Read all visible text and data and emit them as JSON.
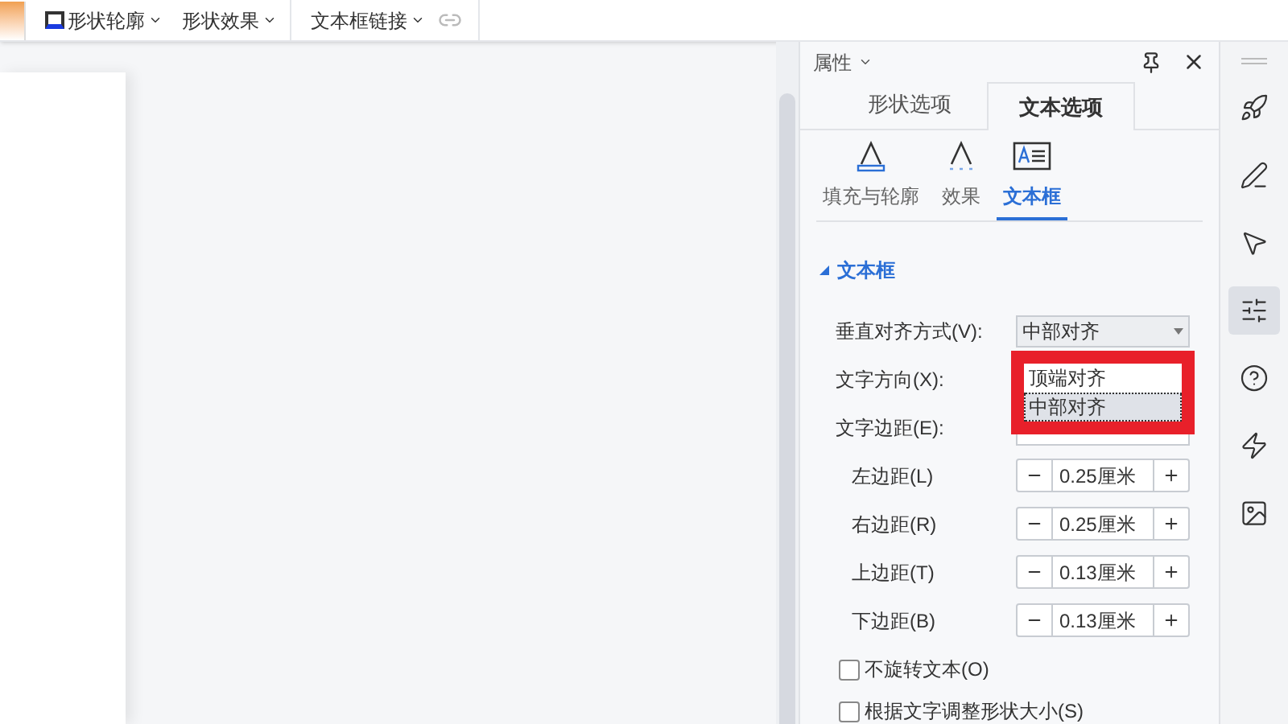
{
  "toolbar": {
    "items": [
      {
        "label": "形状轮廓",
        "kind": "outline"
      },
      {
        "label": "形状效果",
        "kind": "plain"
      },
      {
        "label": "文本框链接",
        "kind": "plain"
      }
    ]
  },
  "panel": {
    "title": "属性",
    "tabs": [
      {
        "label": "形状选项",
        "selected": false
      },
      {
        "label": "文本选项",
        "selected": true
      }
    ],
    "subtabs": [
      {
        "label": "填充与轮廓",
        "kind": "fill",
        "selected": false
      },
      {
        "label": "效果",
        "kind": "effect",
        "selected": false
      },
      {
        "label": "文本框",
        "kind": "textbox",
        "selected": true
      }
    ],
    "section": {
      "title": "文本框",
      "expanded": true
    },
    "vertical_align": {
      "label": "垂直对齐方式(V):",
      "value": "中部对齐"
    },
    "dropdown_options": [
      {
        "label": "顶端对齐",
        "selected": false
      },
      {
        "label": "中部对齐",
        "selected": true
      }
    ],
    "text_direction": {
      "label": "文字方向(X):"
    },
    "text_margin": {
      "label": "文字边距(E):"
    },
    "margins": [
      {
        "label": "左边距(L)",
        "value": "0.25厘米"
      },
      {
        "label": "右边距(R)",
        "value": "0.25厘米"
      },
      {
        "label": "上边距(T)",
        "value": "0.13厘米"
      },
      {
        "label": "下边距(B)",
        "value": "0.13厘米"
      }
    ],
    "checkboxes": [
      {
        "label": "不旋转文本(O)",
        "checked": false
      },
      {
        "label": "根据文字调整形状大小(S)",
        "checked": false
      }
    ]
  },
  "rail": [
    {
      "kind": "rocket",
      "selected": false
    },
    {
      "kind": "pen",
      "selected": false
    },
    {
      "kind": "cursor",
      "selected": false
    },
    {
      "kind": "sliders",
      "selected": true
    },
    {
      "kind": "help",
      "selected": false
    },
    {
      "kind": "bolt",
      "selected": false
    },
    {
      "kind": "image",
      "selected": false
    }
  ]
}
